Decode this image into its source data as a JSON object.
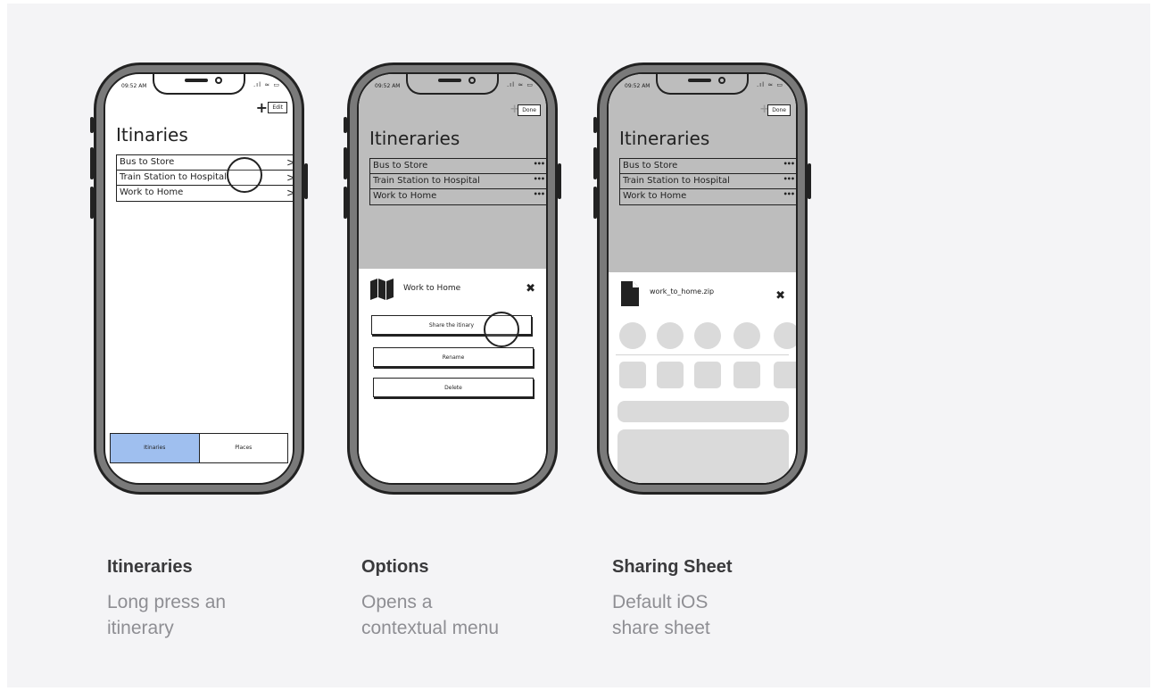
{
  "screens": [
    {
      "time": "09:52 AM",
      "status_icons": ".ıl ≈ ▭",
      "plus_label": "+",
      "edit_label": "Edit",
      "title": "Itinaries",
      "rows": [
        "Bus to Store",
        "Train Station to Hospital",
        "Work to Home"
      ],
      "row_icon": "chevron-right-icon",
      "tabs": [
        "Itinaries",
        "Places"
      ],
      "active_tab_color": "#9fbfef"
    },
    {
      "time": "09:52 AM",
      "status_icons": ".ıl ≈ ▭",
      "plus_label": "+",
      "done_label": "Done",
      "title": "Itineraries",
      "rows": [
        "Bus to Store",
        "Train Station to Hospital",
        "Work to Home"
      ],
      "row_icon": "more-dots-icon",
      "sheet_title": "Work to Home",
      "sheet_icon": "map-icon",
      "close_label": "✖",
      "menu": [
        "Share the itinary",
        "Rename",
        "Delete"
      ]
    },
    {
      "time": "09:52 AM",
      "status_icons": ".ıl ≈ ▭",
      "plus_label": "+",
      "done_label": "Done",
      "title": "Itineraries",
      "rows": [
        "Bus to Store",
        "Train Station to Hospital",
        "Work to Home"
      ],
      "row_icon": "more-dots-icon",
      "file_name": "work_to_home.zip",
      "file_icon": "document-icon",
      "close_label": "✖"
    }
  ],
  "captions": [
    {
      "title": "Itineraries",
      "line1": "Long press an",
      "line2": "itinerary"
    },
    {
      "title": "Options",
      "line1": "Opens a",
      "line2": "contextual menu"
    },
    {
      "title": "Sharing Sheet",
      "line1": "Default iOS",
      "line2": "share sheet"
    }
  ],
  "colors": {
    "background": "#f4f4f6",
    "overlay_gray": "#bdbdbd",
    "placeholder": "#dadada",
    "caption_title": "#3a3a3c",
    "caption_sub": "#8e8e93"
  }
}
